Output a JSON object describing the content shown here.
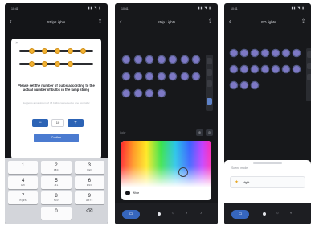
{
  "screens": [
    {
      "status": {
        "time": "10:41",
        "icons": "▮▮ ◥ ▮"
      },
      "header": {
        "title": "Strip Lights",
        "back_icon": "chevron-left-icon",
        "share_icon": "share-icon"
      },
      "dialog": {
        "close_icon": "close-icon",
        "instruction": "Please set the number of bulbs according to the actual number of bulbs in the lamp string",
        "sub_instruction": "Supports a maximum of 48 bulbs connected to one controller",
        "stepper": {
          "minus": "−",
          "value": "10",
          "plus": "+"
        },
        "confirm_label": "Confirm",
        "bulb_color": "#f2b233"
      },
      "keypad": [
        {
          "digit": "1",
          "letters": ""
        },
        {
          "digit": "2",
          "letters": "ABC"
        },
        {
          "digit": "3",
          "letters": "DEF"
        },
        {
          "digit": "4",
          "letters": "GHI"
        },
        {
          "digit": "5",
          "letters": "JKL"
        },
        {
          "digit": "6",
          "letters": "MNO"
        },
        {
          "digit": "7",
          "letters": "PQRS"
        },
        {
          "digit": "8",
          "letters": "TUV"
        },
        {
          "digit": "9",
          "letters": "WXYZ"
        },
        {
          "digit": "",
          "letters": ""
        },
        {
          "digit": "0",
          "letters": ""
        },
        {
          "digit": "⌫",
          "letters": ""
        }
      ]
    },
    {
      "status": {
        "time": "10:41",
        "icons": "▮▮ ◥ ▮"
      },
      "header": {
        "title": "Strip Lights",
        "back_icon": "chevron-left-icon",
        "share_icon": "share-icon"
      },
      "bulb_color": "#7d78c5",
      "panel": {
        "label": "Color",
        "buttons": [
          "⊕",
          "⊘"
        ]
      },
      "picker": {
        "swatch_label": "White",
        "swatch_color": "#15161a"
      },
      "tabbar": {
        "active_icon": "grid-icon",
        "icons": [
          "●",
          "☼",
          "◐",
          "♪"
        ]
      }
    },
    {
      "status": {
        "time": "10:41",
        "icons": "▮▮ ◥ ▮"
      },
      "header": {
        "title": "LED lights",
        "back_icon": "chevron-left-icon",
        "share_icon": "share-icon"
      },
      "bulb_color": "#7d78c5",
      "sheet": {
        "title": "Scene mode",
        "item_icon": "bulb-icon",
        "item_label": "Night"
      },
      "tabbar": {
        "active_icon": "grid-icon",
        "icons": [
          "●",
          "☼",
          "◐"
        ]
      }
    }
  ]
}
